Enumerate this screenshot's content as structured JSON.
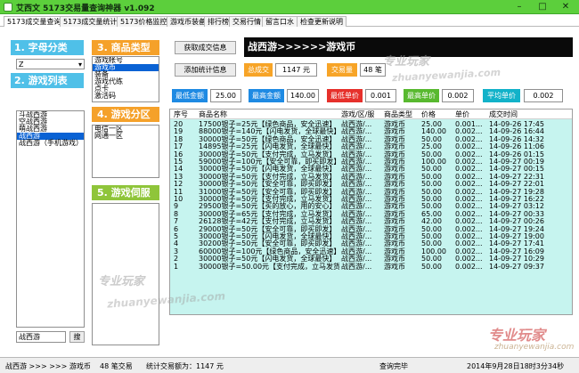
{
  "window": {
    "title": "艾西文 5173交易量查询神器 v1.092"
  },
  "tabs": [
    "5173成交量查询",
    "5173成交量统计",
    "5173价格监控",
    "游戏币装备",
    "排行榜",
    "交易行情",
    "留言口水",
    "检查更新说明"
  ],
  "left": {
    "letter_head": "1. 字母分类",
    "letter_value": "Z",
    "games_head": "2. 游戏列表",
    "games": [
      "斗战西游",
      "空战西游",
      "萌战西游",
      "战西游",
      "战西游（手机游戏）"
    ],
    "games_selected": 3,
    "search_value": "战西游",
    "search_button": "搜"
  },
  "mid": {
    "category_head": "3. 商品类型",
    "categories": [
      "游戏帐号",
      "游戏币",
      "装备",
      "游戏代练",
      "点卡",
      "激活码"
    ],
    "category_selected": 1,
    "region_head": "4. 游戏分区",
    "regions": [
      "电信一区",
      "网通一区"
    ],
    "server_head": "5. 游戏伺服"
  },
  "right": {
    "fetch_button": "获取成交信息",
    "stats_button": "添加统计信息",
    "banner": "战西游>>>>>>游戏币",
    "total_label": "总成交",
    "total_value": "1147 元",
    "volume_label": "交易量",
    "volume_value": "48 笔",
    "min_amount_label": "最低金额",
    "min_amount_value": "25.00",
    "max_amount_label": "最高金额",
    "max_amount_value": "140.00",
    "min_price_label": "最低单价",
    "min_price_value": "0.001",
    "max_price_label": "最高单价",
    "max_price_value": "0.002",
    "avg_price_label": "平均单价",
    "avg_price_value": "0.002"
  },
  "table": {
    "headers": [
      "序号",
      "商品名称",
      "游戏/区/服",
      "商品类型",
      "价格",
      "单价",
      "成交时间"
    ],
    "rows": [
      [
        "20",
        "17500银子=25元【绿色商品，安全迅速】",
        "战西游/...",
        "游戏币",
        "25.00",
        "0.001...",
        "14-09-26 17:45"
      ],
      [
        "19",
        "88000银子=140元【闪电发货，全球最快】",
        "战西游/...",
        "游戏币",
        "140.00",
        "0.002...",
        "14-09-26 16:44"
      ],
      [
        "18",
        "30000银子=50元【绿色商品，安全迅速】",
        "战西游/...",
        "游戏币",
        "50.00",
        "0.002...",
        "14-09-26 14:32"
      ],
      [
        "17",
        "14895银子=25元【闪电发货，全球最快】",
        "战西游/...",
        "游戏币",
        "25.00",
        "0.002...",
        "14-09-26 11:06"
      ],
      [
        "16",
        "30000银子=50元【支付完成，立马发货】",
        "战西游/...",
        "游戏币",
        "50.00",
        "0.002...",
        "14-09-26 01:15"
      ],
      [
        "15",
        "59000银子=100元【安全可靠，即买即发】",
        "战西游/...",
        "游戏币",
        "100.00",
        "0.002...",
        "14-09-27 00:19"
      ],
      [
        "14",
        "30000银子=50元【闪电发货，全球最快】",
        "战西游/...",
        "游戏币",
        "50.00",
        "0.002...",
        "14-09-27 00:15"
      ],
      [
        "13",
        "30000银子=50元【支付完成，立马发货】",
        "战西游/...",
        "游戏币",
        "50.00",
        "0.002...",
        "14-09-27 22:31"
      ],
      [
        "12",
        "30000银子=50元【安全可靠，即买即发】",
        "战西游/...",
        "游戏币",
        "50.00",
        "0.002...",
        "14-09-27 22:01"
      ],
      [
        "11",
        "31000银子=50元【安全可靠，即买即发】",
        "战西游/...",
        "游戏币",
        "50.00",
        "0.002...",
        "14-09-27 19:28"
      ],
      [
        "10",
        "30000银子=50元【支付完成，立马发货】",
        "战西游/...",
        "游戏币",
        "50.00",
        "0.002...",
        "14-09-27 16:22"
      ],
      [
        "9",
        "29500银子=50元【买的放心，用的安心】",
        "战西游/...",
        "游戏币",
        "50.00",
        "0.002...",
        "14-09-27 03:12"
      ],
      [
        "8",
        "30000银子=65元【支付完成，立马发货】",
        "战西游/...",
        "游戏币",
        "65.00",
        "0.002...",
        "14-09-27 00:33"
      ],
      [
        "7",
        "26128银子=42元【支付完成，立马发货】",
        "战西游/...",
        "游戏币",
        "42.00",
        "0.002...",
        "14-09-27 00:26"
      ],
      [
        "6",
        "29000银子=50元【安全可靠，即买即发】",
        "战西游/...",
        "游戏币",
        "50.00",
        "0.002...",
        "14-09-27 19:24"
      ],
      [
        "5",
        "30000银子=50元【闪电发货，全球最快】",
        "战西游/...",
        "游戏币",
        "50.00",
        "0.002...",
        "14-09-27 19:00"
      ],
      [
        "4",
        "30200银子=50元【安全可靠，即买即发】",
        "战西游/...",
        "游戏币",
        "50.00",
        "0.002...",
        "14-09-27 17:41"
      ],
      [
        "3",
        "60000银子=100元【绿色商品，安全迅速】",
        "战西游/...",
        "游戏币",
        "100.00",
        "0.002...",
        "14-09-27 16:09"
      ],
      [
        "2",
        "30000银子=50元【闪电发货，全球最快】",
        "战西游/...",
        "游戏币",
        "50.00",
        "0.002...",
        "14-09-27 10:29"
      ],
      [
        "1",
        "30000银子=50.00元【支付完成，立马发货】",
        "战西游/...",
        "游戏币",
        "50.00",
        "0.002...",
        "14-09-27 09:37"
      ]
    ]
  },
  "status": {
    "path": "战西游 >>> >>> 游戏币",
    "count": "48 笔交易",
    "total": "统计交易额为：1147 元",
    "query_status": "查询完毕",
    "datetime": "2014年9月28日18时3分34秒"
  },
  "watermark": {
    "brand": "专业玩家",
    "domain": "zhuanyewanjia.com"
  }
}
